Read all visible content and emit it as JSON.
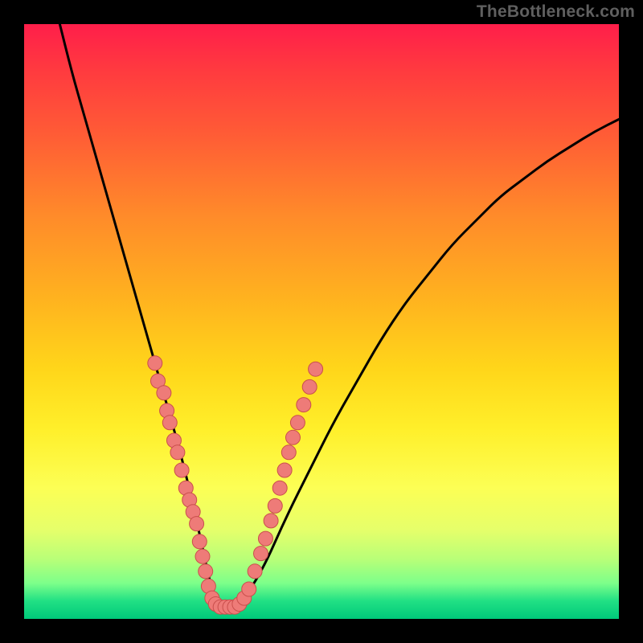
{
  "watermark": "TheBottleneck.com",
  "chart_data": {
    "type": "line",
    "title": "",
    "xlabel": "",
    "ylabel": "",
    "xlim": [
      0,
      100
    ],
    "ylim": [
      0,
      100
    ],
    "grid": false,
    "series": [
      {
        "name": "curve",
        "x": [
          6,
          8,
          10,
          12,
          14,
          16,
          18,
          20,
          22,
          24,
          26,
          28,
          30,
          31.5,
          33,
          36,
          40,
          44,
          48,
          52,
          56,
          60,
          64,
          68,
          72,
          76,
          80,
          84,
          88,
          92,
          96,
          100
        ],
        "y": [
          100,
          92,
          85,
          78,
          71,
          64,
          57,
          50,
          43,
          36,
          29,
          21,
          12,
          5,
          2,
          2,
          8,
          17,
          25,
          33,
          40,
          47,
          53,
          58,
          63,
          67,
          71,
          74,
          77,
          79.5,
          82,
          84
        ]
      }
    ],
    "markers": [
      {
        "x": 22.0,
        "y": 43.0
      },
      {
        "x": 22.5,
        "y": 40.0
      },
      {
        "x": 23.5,
        "y": 38.0
      },
      {
        "x": 24.0,
        "y": 35.0
      },
      {
        "x": 24.5,
        "y": 33.0
      },
      {
        "x": 25.2,
        "y": 30.0
      },
      {
        "x": 25.8,
        "y": 28.0
      },
      {
        "x": 26.5,
        "y": 25.0
      },
      {
        "x": 27.2,
        "y": 22.0
      },
      {
        "x": 27.8,
        "y": 20.0
      },
      {
        "x": 28.4,
        "y": 18.0
      },
      {
        "x": 29.0,
        "y": 16.0
      },
      {
        "x": 29.5,
        "y": 13.0
      },
      {
        "x": 30.0,
        "y": 10.5
      },
      {
        "x": 30.5,
        "y": 8.0
      },
      {
        "x": 31.0,
        "y": 5.5
      },
      {
        "x": 31.6,
        "y": 3.5
      },
      {
        "x": 32.2,
        "y": 2.5
      },
      {
        "x": 33.0,
        "y": 2.0
      },
      {
        "x": 33.8,
        "y": 2.0
      },
      {
        "x": 34.6,
        "y": 2.0
      },
      {
        "x": 35.4,
        "y": 2.0
      },
      {
        "x": 36.2,
        "y": 2.5
      },
      {
        "x": 37.0,
        "y": 3.5
      },
      {
        "x": 37.8,
        "y": 5.0
      },
      {
        "x": 38.8,
        "y": 8.0
      },
      {
        "x": 39.8,
        "y": 11.0
      },
      {
        "x": 40.6,
        "y": 13.5
      },
      {
        "x": 41.5,
        "y": 16.5
      },
      {
        "x": 42.2,
        "y": 19.0
      },
      {
        "x": 43.0,
        "y": 22.0
      },
      {
        "x": 43.8,
        "y": 25.0
      },
      {
        "x": 44.5,
        "y": 28.0
      },
      {
        "x": 45.2,
        "y": 30.5
      },
      {
        "x": 46.0,
        "y": 33.0
      },
      {
        "x": 47.0,
        "y": 36.0
      },
      {
        "x": 48.0,
        "y": 39.0
      },
      {
        "x": 49.0,
        "y": 42.0
      }
    ],
    "marker_style": {
      "fill": "#ee7b78",
      "stroke": "#c94f4c",
      "r": 9
    },
    "curve_style": {
      "stroke": "#000000",
      "width": 3
    }
  }
}
